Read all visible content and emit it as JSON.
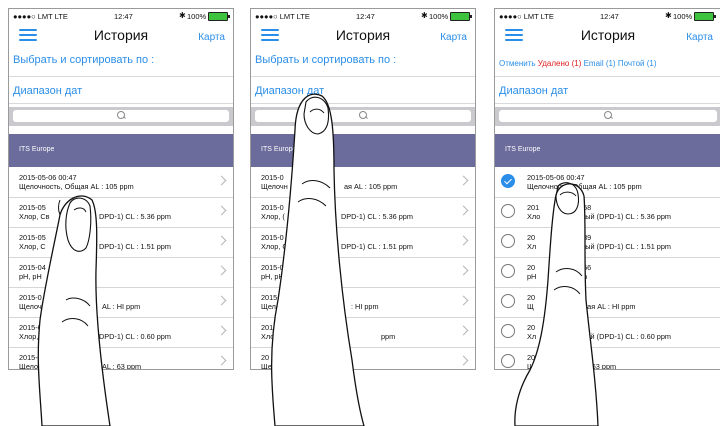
{
  "status": {
    "carrier": "●●●●○ LMT LTE",
    "time": "12:47",
    "bluetooth": "✱",
    "battery": "100%"
  },
  "nav": {
    "title": "История",
    "map_label": "Карта"
  },
  "filter": {
    "label": "Выбрать и сортировать по :",
    "cancel": "Отменить",
    "deleted": "Удалено (1)",
    "email": "Email (1)",
    "mail": "Почтой (1)"
  },
  "date_range": "Диапазон дат",
  "section": "ITS Europe",
  "panel1": {
    "rows": [
      {
        "date": "2015-05-06 00:47",
        "text": "Щелочность, Общая AL : 105 ppm"
      },
      {
        "date": "2015-05",
        "text": "Хлор, Св",
        "text2": "DPD-1) CL : 5.36 ppm"
      },
      {
        "date": "2015-05",
        "text": "Хлор, С",
        "text2": "DPD-1) CL : 1.51 ppm"
      },
      {
        "date": "2015-04",
        "text": "pH, pH"
      },
      {
        "date": "2015-0",
        "text": "Щелочн",
        "text2": "AL : HI ppm"
      },
      {
        "date": "2015-0",
        "text": "Хлор, (",
        "text2": "DPD-1) CL : 0.60 ppm"
      },
      {
        "date": "2015-0",
        "text": "Щелочн",
        "text2": "AL : 63 ppm"
      }
    ]
  },
  "panel2": {
    "rows": [
      {
        "date": "2015-0",
        "text": "Щелочн",
        "text2": "ая AL : 105 ppm"
      },
      {
        "date": "2015-0",
        "text": "Хлор, (",
        "text2": "DPD-1) CL : 5.36 ppm"
      },
      {
        "date": "2015-0",
        "text": "Хлор, С",
        "text2": "DPD-1) CL : 1.51 ppm"
      },
      {
        "date": "2015-04",
        "text": "pH, pH"
      },
      {
        "date": "2015-04",
        "text": "Щелочн",
        "text2": ": HI ppm"
      },
      {
        "date": "2015-02",
        "text": "Хлор, С",
        "text2": "ppm"
      },
      {
        "date": "20",
        "text": "Ще"
      }
    ]
  },
  "panel3": {
    "rows": [
      {
        "date": "2015-05-06 00:47",
        "text": "Щелочность, Общая AL : 105 ppm",
        "checked": true
      },
      {
        "date": "201",
        "date2": "9:58",
        "text": "Хло",
        "text2": "дный (DPD-1) CL : 5.36 ppm"
      },
      {
        "date": "20",
        "date2": "9:39",
        "text": "Хл",
        "text2": "дный (DPD-1) CL : 1.51 ppm"
      },
      {
        "date": "20",
        "date2": "7:56",
        "text": "pH",
        "text2": "pm"
      },
      {
        "date": "20",
        "date2": "47",
        "text": "Щ",
        "text2": "бщая AL : HI ppm"
      },
      {
        "date": "20",
        "date2": "34",
        "text": "Хл",
        "text2": "дный (DPD-1) CL : 0.60 ppm"
      },
      {
        "date": "20",
        "date2": "5",
        "text": "Ще",
        "text2": "AL : 63 ppm"
      }
    ]
  },
  "colors": {
    "accent": "#2a8ee8",
    "section_bg": "#6b6b9c",
    "deleted": "#e02020",
    "battery": "#3ec33e"
  },
  "icons": [
    "hamburger-icon",
    "search-icon",
    "chevron-right-icon",
    "checkmark-icon",
    "finger-icon",
    "battery-icon",
    "bluetooth-icon"
  ]
}
